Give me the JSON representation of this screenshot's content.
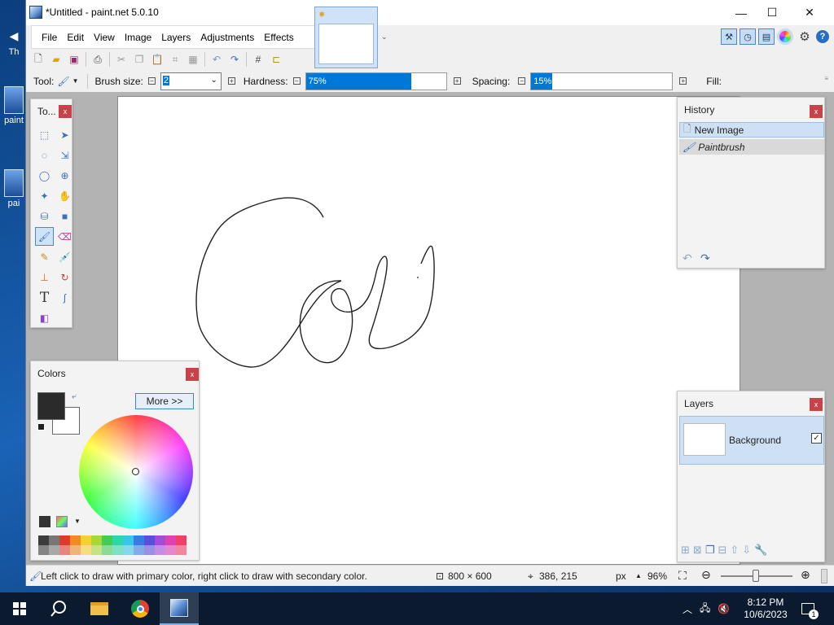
{
  "desktop": {
    "icons": [
      {
        "label": "Th"
      },
      {
        "label": "paint"
      },
      {
        "label": "pai"
      }
    ]
  },
  "window": {
    "title": "*Untitled - paint.net 5.0.10",
    "minimize_glyph": "—",
    "maximize_glyph": "☐",
    "close_glyph": "✕"
  },
  "menu": {
    "items": [
      "File",
      "Edit",
      "View",
      "Image",
      "Layers",
      "Adjustments",
      "Effects"
    ]
  },
  "toolbar": {
    "tool_label": "Tool:",
    "brush_size_label": "Brush size:",
    "brush_size_value": "2",
    "hardness_label": "Hardness:",
    "hardness_value": "75%",
    "hardness_percent": 75,
    "spacing_label": "Spacing:",
    "spacing_value": "15%",
    "spacing_percent": 15,
    "fill_label": "Fill:"
  },
  "tools_panel": {
    "title": "To...",
    "close": "x"
  },
  "colors_panel": {
    "title": "Colors",
    "close": "x",
    "more_button": "More >>",
    "primary_color": "#2b2b2b",
    "secondary_color": "#ffffff",
    "palette": [
      "#3c3c3c",
      "#777777",
      "#e03a2c",
      "#f08a24",
      "#f5d032",
      "#a6d83a",
      "#44cc55",
      "#2ed6a8",
      "#38c6e8",
      "#3a7be0",
      "#5a4fd8",
      "#a44ad8",
      "#e040b0",
      "#f04068"
    ]
  },
  "history_panel": {
    "title": "History",
    "close": "x",
    "items": [
      {
        "label": "New Image"
      },
      {
        "label": "Paintbrush"
      }
    ]
  },
  "layers_panel": {
    "title": "Layers",
    "close": "x",
    "layer_name": "Background"
  },
  "status": {
    "hint": "Left click to draw with primary color, right click to draw with secondary color.",
    "image_size": "800 × 600",
    "cursor_pos": "386, 215",
    "units": "px",
    "zoom": "96%"
  },
  "taskbar": {
    "time": "8:12 PM",
    "date": "10/6/2023",
    "notifications": "1"
  }
}
